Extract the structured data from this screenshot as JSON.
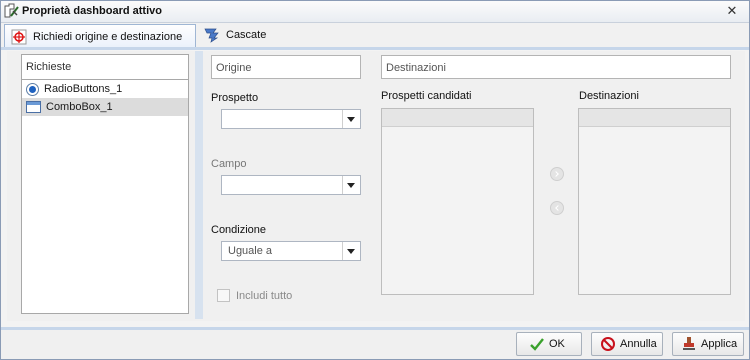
{
  "window": {
    "title": "Proprietà dashboard attivo",
    "close_symbol": "✕"
  },
  "tabs": [
    {
      "label": "Richiedi origine e destinazione",
      "icon": "target-icon",
      "active": true
    },
    {
      "label": "Cascate",
      "icon": "cascade-icon",
      "active": false
    }
  ],
  "requests": {
    "header": "Richieste",
    "items": [
      {
        "label": "RadioButtons_1",
        "icon": "radio-icon",
        "selected": false
      },
      {
        "label": "ComboBox_1",
        "icon": "combobox-icon",
        "selected": true
      }
    ]
  },
  "origin": {
    "header": "Origine",
    "report_label": "Prospetto",
    "report_value": "",
    "field_label": "Campo",
    "field_value": "",
    "condition_label": "Condizione",
    "condition_value": "Uguale a",
    "include_all_label": "Includi tutto"
  },
  "destinations": {
    "header": "Destinazioni",
    "candidates_label": "Prospetti candidati",
    "targets_label": "Destinazioni"
  },
  "footer": {
    "ok_label": "OK",
    "cancel_label": "Annulla",
    "apply_label": "Applica"
  },
  "colors": {
    "accent": "#c6d6ea",
    "divider": "#d7e2ef",
    "active_tab": "#eaf1fb"
  }
}
